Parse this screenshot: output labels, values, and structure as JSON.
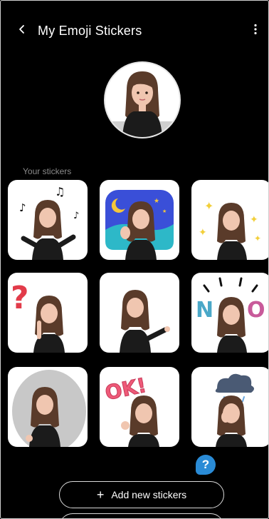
{
  "header": {
    "title": "My Emoji Stickers",
    "back_icon": "chevron-left-icon",
    "more_icon": "more-vert-icon"
  },
  "profile": {
    "avatar": "avatar-emoji"
  },
  "section": {
    "label": "Your stickers"
  },
  "stickers": [
    {
      "name": "sticker-music",
      "background": "#ffffff"
    },
    {
      "name": "sticker-good-night",
      "background": "#3a4fd8"
    },
    {
      "name": "sticker-sparkles",
      "background": "#ffffff"
    },
    {
      "name": "sticker-question",
      "background": "#ffffff",
      "text": "?"
    },
    {
      "name": "sticker-pointing",
      "background": "#ffffff"
    },
    {
      "name": "sticker-no",
      "background": "#ffffff",
      "text": "NO"
    },
    {
      "name": "sticker-spotlight",
      "background": "#ffffff"
    },
    {
      "name": "sticker-ok",
      "background": "#ffffff",
      "text": "OK!"
    },
    {
      "name": "sticker-rain-cloud",
      "background": "#ffffff"
    }
  ],
  "help": {
    "label": "?"
  },
  "actions": {
    "add_label": "Add new stickers",
    "add_icon": "plus-icon"
  },
  "colors": {
    "accent": "#2a8bd6",
    "hair": "#5a3b2a",
    "shirt": "#1b1b1b",
    "skin": "#f0c6b0"
  }
}
